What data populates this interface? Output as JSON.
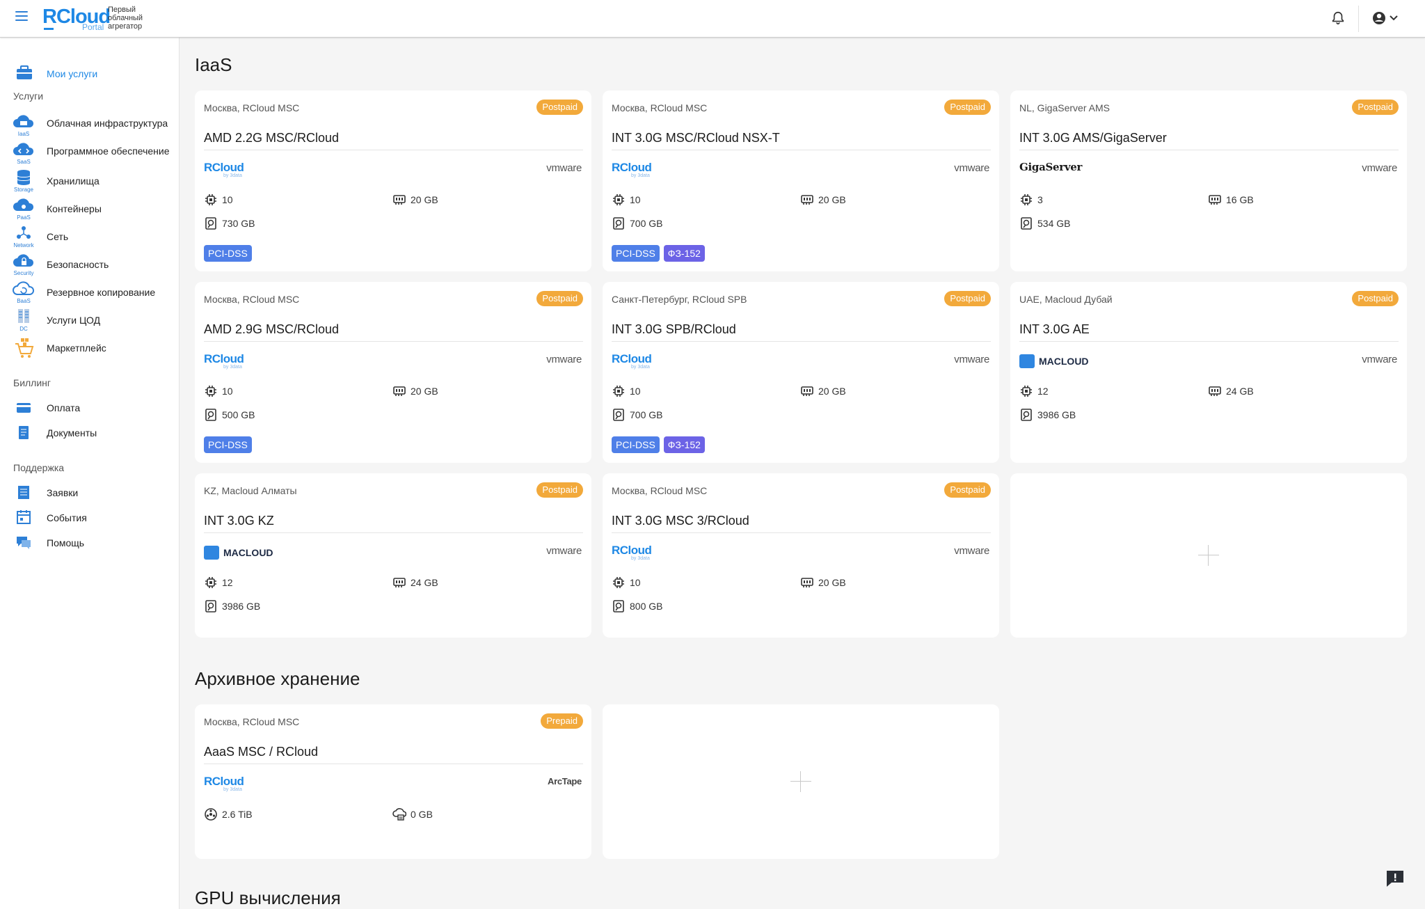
{
  "header": {
    "logo_main": "RCloud",
    "logo_sub": "Portal",
    "logo_tagline": "Первый облачный агрегатор"
  },
  "sidebar": {
    "my_services": "Мои услуги",
    "sections": {
      "services": "Услуги",
      "billing": "Биллинг",
      "support": "Поддержка"
    },
    "services": [
      {
        "label": "Облачная инфраструктура",
        "caption": "IaaS",
        "icon": "cloud-iaas-icon"
      },
      {
        "label": "Программное обеспечение",
        "caption": "SaaS",
        "icon": "cloud-saas-icon"
      },
      {
        "label": "Хранилища",
        "caption": "Storage",
        "icon": "storage-icon"
      },
      {
        "label": "Контейнеры",
        "caption": "PaaS",
        "icon": "cloud-paas-icon"
      },
      {
        "label": "Сеть",
        "caption": "Network",
        "icon": "network-icon"
      },
      {
        "label": "Безопасность",
        "caption": "Security",
        "icon": "security-icon"
      },
      {
        "label": "Резервное копирование",
        "caption": "BaaS",
        "icon": "backup-icon"
      },
      {
        "label": "Услуги ЦОД",
        "caption": "DC",
        "icon": "datacenter-icon"
      },
      {
        "label": "Маркетплейс",
        "caption": "",
        "icon": "cart-icon"
      }
    ],
    "billing": [
      {
        "label": "Оплата",
        "icon": "card-icon"
      },
      {
        "label": "Документы",
        "icon": "document-icon"
      }
    ],
    "support": [
      {
        "label": "Заявки",
        "icon": "tickets-icon"
      },
      {
        "label": "События",
        "icon": "events-icon"
      },
      {
        "label": "Помощь",
        "icon": "help-chat-icon"
      }
    ]
  },
  "sections": {
    "iaas": "IaaS",
    "archive": "Архивное хранение",
    "gpu": "GPU вычисления"
  },
  "colors": {
    "accent": "#1e88e5",
    "badge": "#f2a93b",
    "tag_pci": "#4f7fe8",
    "tag_fz": "#6c63e6"
  },
  "iaas_cards": [
    {
      "location": "Москва, RCloud MSC",
      "badge": "Postpaid",
      "name": "AMD 2.2G MSC/RCloud",
      "provider": "RCloud",
      "virt": "vmware",
      "cpu": "10",
      "ram": "20 GB",
      "disk": "730 GB",
      "tags": [
        "PCI-DSS"
      ]
    },
    {
      "location": "Москва, RCloud MSC",
      "badge": "Postpaid",
      "name": "INT 3.0G MSC/RCloud NSX-T",
      "provider": "RCloud",
      "virt": "vmware",
      "cpu": "10",
      "ram": "20 GB",
      "disk": "700 GB",
      "tags": [
        "PCI-DSS",
        "ФЗ-152"
      ]
    },
    {
      "location": "NL, GigaServer AMS",
      "badge": "Postpaid",
      "name": "INT 3.0G AMS/GigaServer",
      "provider": "GigaServer",
      "virt": "vmware",
      "cpu": "3",
      "ram": "16 GB",
      "disk": "534 GB",
      "tags": []
    },
    {
      "location": "Москва, RCloud MSC",
      "badge": "Postpaid",
      "name": "AMD 2.9G MSC/RCloud",
      "provider": "RCloud",
      "virt": "vmware",
      "cpu": "10",
      "ram": "20 GB",
      "disk": "500 GB",
      "tags": [
        "PCI-DSS"
      ]
    },
    {
      "location": "Санкт-Петербург, RCloud SPB",
      "badge": "Postpaid",
      "name": "INT 3.0G SPB/RCloud",
      "provider": "RCloud",
      "virt": "vmware",
      "cpu": "10",
      "ram": "20 GB",
      "disk": "700 GB",
      "tags": [
        "PCI-DSS",
        "ФЗ-152"
      ]
    },
    {
      "location": "UAE, Macloud Дубай",
      "badge": "Postpaid",
      "name": "INT 3.0G AE",
      "provider": "MACLOUD",
      "virt": "vmware",
      "cpu": "12",
      "ram": "24 GB",
      "disk": "3986 GB",
      "tags": []
    },
    {
      "location": "KZ, Macloud Алматы",
      "badge": "Postpaid",
      "name": "INT 3.0G KZ",
      "provider": "MACLOUD",
      "virt": "vmware",
      "cpu": "12",
      "ram": "24 GB",
      "disk": "3986 GB",
      "tags": []
    },
    {
      "location": "Москва, RCloud MSC",
      "badge": "Postpaid",
      "name": "INT 3.0G MSC 3/RCloud",
      "provider": "RCloud",
      "virt": "vmware",
      "cpu": "10",
      "ram": "20 GB",
      "disk": "800 GB",
      "tags": []
    }
  ],
  "archive_cards": [
    {
      "location": "Москва, RCloud MSC",
      "badge": "Prepaid",
      "name": "AaaS MSC / RCloud",
      "provider": "RCloud",
      "virt": "ArcTape",
      "tape": "2.6 TiB",
      "cache": "0 GB"
    }
  ],
  "rcloud_logo": {
    "text": "RCloud",
    "sub": "by 3data"
  }
}
